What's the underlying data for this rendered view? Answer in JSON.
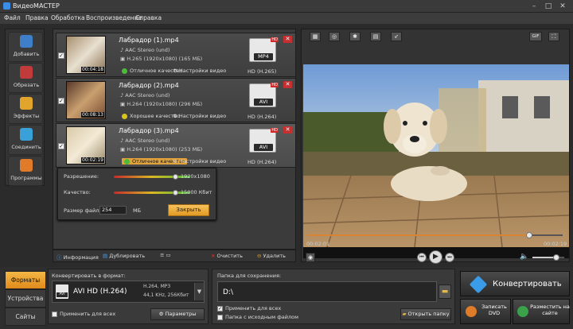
{
  "window": {
    "title": "ВидеоМАСТЕР",
    "min": "–",
    "max": "□",
    "close": "✕"
  },
  "menu": [
    "Файл",
    "Правка",
    "Обработка",
    "Воспроизведение",
    "Справка"
  ],
  "tools": [
    "Добавить",
    "Обрезать",
    "Эффекты",
    "Соединить",
    "Программы"
  ],
  "files": [
    {
      "name": "Лабрадор (1).mp4",
      "duration": "00:04:18",
      "audio": "AAC Stereo (und)",
      "video": "H.265 (1920x1080) (165 МБ)",
      "quality": "Отличное качество",
      "settings": "Настройки видео",
      "format": "MP4",
      "format_label": "HD (H.265)",
      "quality_color": "#4dbb3a"
    },
    {
      "name": "Лабрадор (2).mp4",
      "duration": "00:08:13",
      "audio": "AAC Stereo (und)",
      "video": "H.264 (1920x1080) (296 МБ)",
      "quality": "Хорошее качество",
      "settings": "Настройки видео",
      "format": "AVI",
      "format_label": "HD (H.264)",
      "quality_color": "#d9c31e"
    },
    {
      "name": "Лабрадор (3).mp4",
      "duration": "00:02:19",
      "audio": "AAC Stereo (und)",
      "video": "H.264 (1920x1080) (253 МБ)",
      "quality": "Отличное качество",
      "settings": "Настройки видео",
      "format": "AVI",
      "format_label": "HD (H.264)",
      "quality_color": "#4dbb3a"
    }
  ],
  "hd_badge": "HD",
  "popup": {
    "resolution_label": "Разрешение:",
    "resolution_value": "1920x1080",
    "quality_label": "Качество:",
    "quality_value": "15000 Кбит",
    "size_label": "Размер файла:",
    "size_value": "254",
    "size_unit": "МБ",
    "close": "Закрыть"
  },
  "listbar": {
    "info": "Информация",
    "duplicate": "Дублировать",
    "clear": "Очистить",
    "delete": "Удалить"
  },
  "player": {
    "time_current": "00:02:01",
    "time_total": "00:02:19",
    "progress": 0.87,
    "volume": 0.75,
    "gif": "GIF"
  },
  "footer": {
    "tabs": [
      "Форматы",
      "Устройства",
      "Сайты"
    ],
    "convert_to_label": "Конвертировать в формат:",
    "format_name": "AVI HD (H.264)",
    "format_badge": "AVI",
    "format_spec1": "H.264, MP3",
    "format_spec2": "44,1 KHz, 256Кбит",
    "apply_all": "Применить для всех",
    "params": "Параметры",
    "save_folder_label": "Папка для сохранения:",
    "save_folder": "D:\\",
    "apply_all2": "Применить для всех",
    "same_folder": "Папка с исходным файлом",
    "open_folder": "Открыть папку",
    "convert": "Конвертировать",
    "burn_dvd": "Записать DVD",
    "publish": "Разместить на сайте"
  }
}
